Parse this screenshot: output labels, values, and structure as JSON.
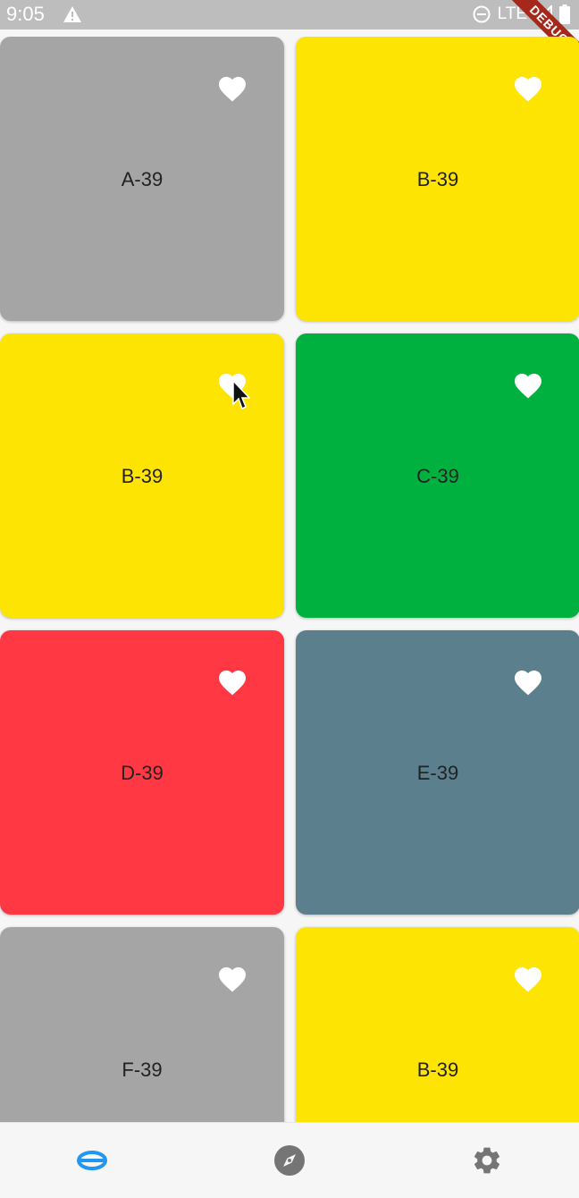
{
  "status_bar": {
    "time": "9:05",
    "network": "LTE",
    "icons": [
      "warning-icon",
      "do-not-disturb-icon",
      "signal-icon",
      "battery-icon"
    ]
  },
  "debug_banner": "DEBUG",
  "cards": [
    {
      "label": "A-39",
      "color": "#a6a5a6"
    },
    {
      "label": "B-39",
      "color": "#fde403"
    },
    {
      "label": "B-39",
      "color": "#fde403"
    },
    {
      "label": "C-39",
      "color": "#00b140"
    },
    {
      "label": "D-39",
      "color": "#ff3844"
    },
    {
      "label": "E-39",
      "color": "#5b7f8d"
    },
    {
      "label": "F-39",
      "color": "#a6a5a6"
    },
    {
      "label": "B-39",
      "color": "#fde403"
    }
  ],
  "bottom_nav": {
    "items": [
      {
        "icon": "ellipse-list-icon",
        "selected": true
      },
      {
        "icon": "compass-icon",
        "selected": false
      },
      {
        "icon": "settings-gear-icon",
        "selected": false
      }
    ],
    "selected_color": "#2196f3",
    "unselected_color": "#757575"
  }
}
